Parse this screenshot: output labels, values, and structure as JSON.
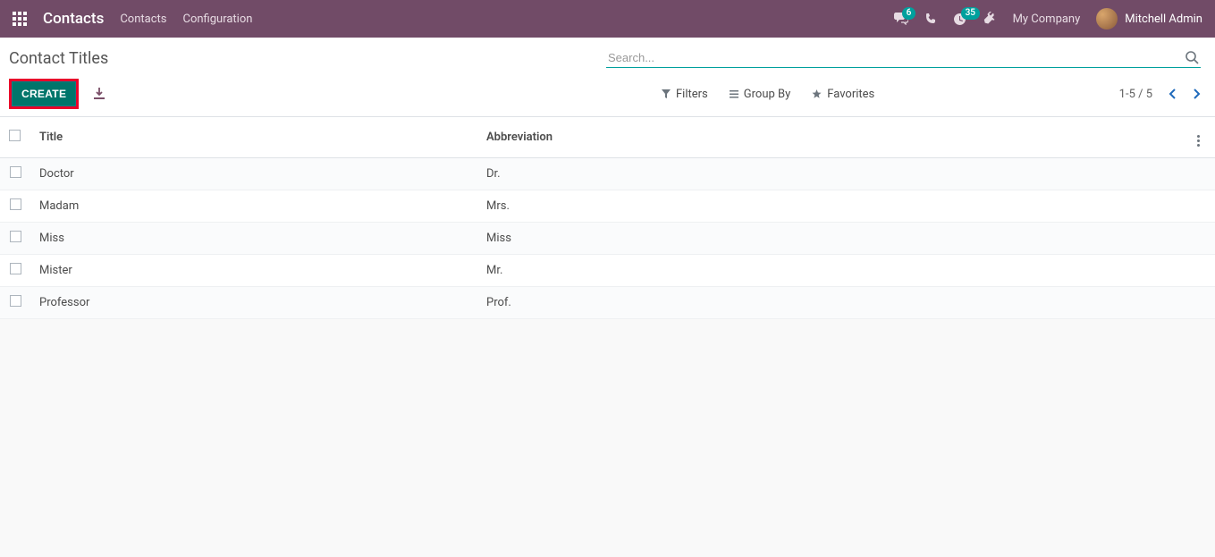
{
  "nav": {
    "brand": "Contacts",
    "links": [
      "Contacts",
      "Configuration"
    ],
    "chat_badge": "6",
    "activity_badge": "35",
    "company": "My Company",
    "user": "Mitchell Admin"
  },
  "breadcrumb": "Contact Titles",
  "search": {
    "placeholder": "Search..."
  },
  "buttons": {
    "create": "CREATE",
    "filters": "Filters",
    "groupby": "Group By",
    "favorites": "Favorites"
  },
  "pager": {
    "text": "1-5 / 5"
  },
  "columns": {
    "title": "Title",
    "abbr": "Abbreviation"
  },
  "rows": [
    {
      "title": "Doctor",
      "abbr": "Dr."
    },
    {
      "title": "Madam",
      "abbr": "Mrs."
    },
    {
      "title": "Miss",
      "abbr": "Miss"
    },
    {
      "title": "Mister",
      "abbr": "Mr."
    },
    {
      "title": "Professor",
      "abbr": "Prof."
    }
  ]
}
